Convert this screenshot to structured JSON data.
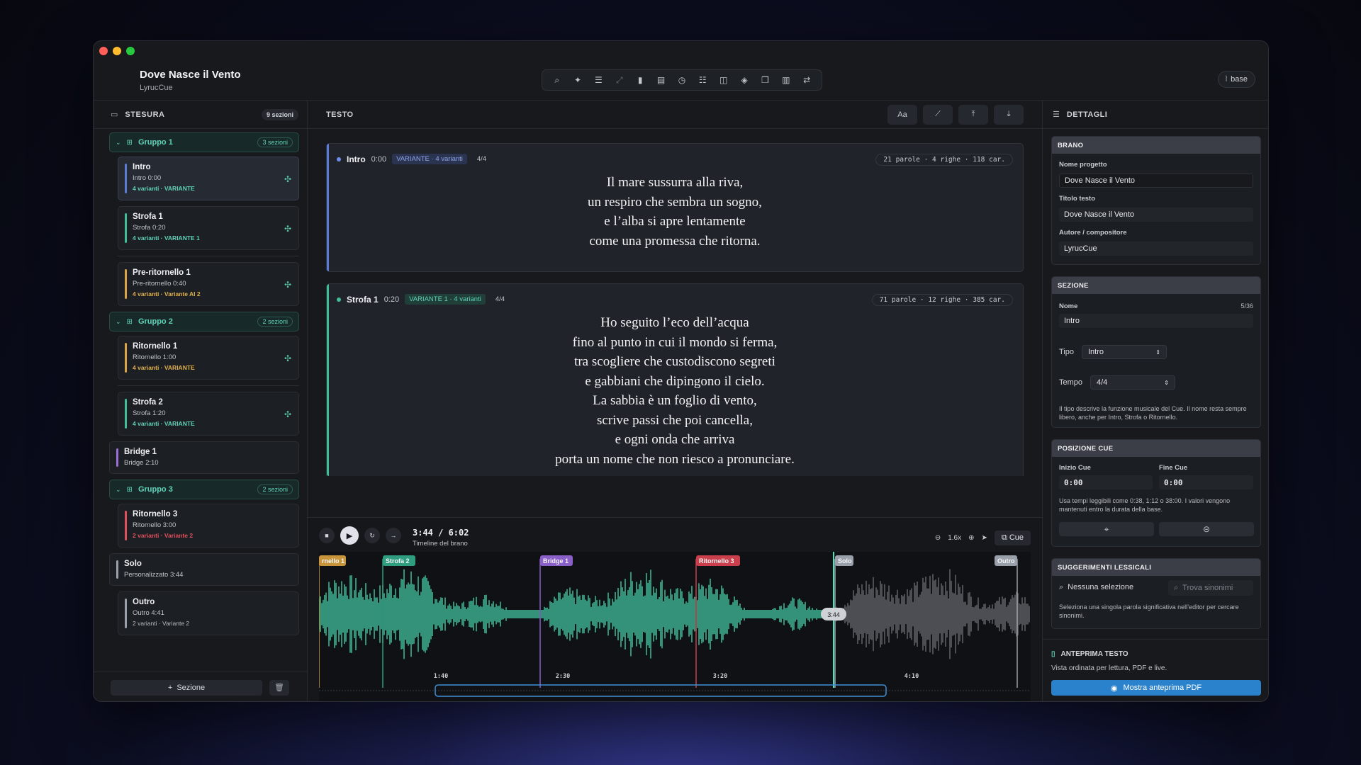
{
  "app": {
    "title": "Dove Nasce il Vento",
    "subtitle": "LyrucCue",
    "base_label": "base"
  },
  "toolbar_icons": [
    "search-icon",
    "sparkle-icon",
    "list-icon",
    "expand-icon",
    "waveform-icon",
    "document-icon",
    "timer-icon",
    "checklist-icon",
    "columns-icon",
    "layers-icon",
    "bookmark-icon",
    "notes-icon",
    "route-icon"
  ],
  "left": {
    "header": "STESURA",
    "count": "9 sezioni",
    "groups": [
      {
        "label": "Gruppo 1",
        "count": "3 sezioni"
      },
      {
        "label": "Gruppo 2",
        "count": "2 sezioni"
      },
      {
        "label": "Gruppo 3",
        "count": "2 sezioni"
      }
    ],
    "items": [
      {
        "name": "Intro",
        "meta": "Intro  0:00",
        "variant": "4 varianti · VARIANTE",
        "color": "#5b7bd8",
        "vcolor": "#5fd3b8"
      },
      {
        "name": "Strofa 1",
        "meta": "Strofa  0:20",
        "variant": "4 varianti · VARIANTE 1",
        "color": "#3fbf96",
        "vcolor": "#5fd3b8"
      },
      {
        "name": "Pre-ritornello 1",
        "meta": "Pre-ritornello  0:40",
        "variant": "4 varianti · Variante AI 2",
        "color": "#d9a441",
        "vcolor": "#e0b04c"
      },
      {
        "name": "Ritornello 1",
        "meta": "Ritornello  1:00",
        "variant": "4 varianti · VARIANTE",
        "color": "#d9a441",
        "vcolor": "#e0b04c"
      },
      {
        "name": "Strofa 2",
        "meta": "Strofa  1:20",
        "variant": "4 varianti · VARIANTE",
        "color": "#3fbf96",
        "vcolor": "#5fd3b8"
      },
      {
        "name": "Bridge 1",
        "meta": "Bridge  2:10",
        "variant": "",
        "color": "#9b6fd6",
        "vcolor": "#9b6fd6"
      },
      {
        "name": "Ritornello 3",
        "meta": "Ritornello  3:00",
        "variant": "2 varianti · Variante 2",
        "color": "#e0505c",
        "vcolor": "#e0505c"
      },
      {
        "name": "Solo",
        "meta": "Personalizzato  3:44",
        "variant": "",
        "color": "#9aa0aa",
        "vcolor": "#9aa0aa"
      },
      {
        "name": "Outro",
        "meta": "Outro  4:41",
        "variant": "2 varianti · Variante 2",
        "color": "#9aa0aa",
        "vcolor": "#b8bbc2"
      }
    ],
    "add_label": "Sezione"
  },
  "center": {
    "header": "TESTO",
    "tool_aa": "Aa",
    "cards": [
      {
        "name": "Intro",
        "time": "0:00",
        "variant": "VARIANTE · 4 varianti",
        "meter": "4/4",
        "stats": "21 parole · 4 righe · 118 car.",
        "lines": [
          "Il mare sussurra alla riva,",
          "un respiro che sembra un sogno,",
          "e l’alba si apre lentamente",
          "come una promessa che ritorna."
        ]
      },
      {
        "name": "Strofa 1",
        "time": "0:20",
        "variant": "VARIANTE 1 · 4 varianti",
        "meter": "4/4",
        "stats": "71 parole · 12 righe · 385 car.",
        "lines": [
          "Ho seguito l’eco dell’acqua",
          "fino al punto in cui il mondo si ferma,",
          "tra scogliere che custodiscono segreti",
          "e gabbiani che dipingono il cielo.",
          "La sabbia è un foglio di vento,",
          "scrive passi che poi cancella,",
          "e ogni onda che arriva",
          "porta un nome che non riesco a pronunciare."
        ]
      }
    ],
    "player": {
      "time": "3:44 / 6:02",
      "caption": "Timeline del brano",
      "zoom": "1.6x",
      "cue_label": "Cue",
      "playhead_label": "3:44",
      "markers": [
        {
          "label": "rnello 1",
          "color": "#c8953a"
        },
        {
          "label": "Strofa 2",
          "color": "#2f9e80"
        },
        {
          "label": "Bridge 1",
          "color": "#8a5fc8"
        },
        {
          "label": "Ritornello 3",
          "color": "#c9404c"
        },
        {
          "label": "Solo",
          "color": "#9aa0aa"
        },
        {
          "label": "Outro",
          "color": "#9aa0aa"
        }
      ],
      "ticks": [
        "1:40",
        "2:30",
        "3:20",
        "4:10"
      ]
    }
  },
  "right": {
    "header": "DETTAGLI",
    "brano": {
      "title": "BRANO",
      "project_label": "Nome progetto",
      "project": "Dove Nasce il Vento",
      "text_label": "Titolo testo",
      "text_title": "Dove Nasce il Vento",
      "author_label": "Autore / compositore",
      "author": "LyrucCue"
    },
    "sezione": {
      "title": "SEZIONE",
      "name_label": "Nome",
      "name_count": "5/36",
      "name": "Intro",
      "tipo_label": "Tipo",
      "tipo": "Intro",
      "tempo_label": "Tempo",
      "tempo": "4/4",
      "help": "Il tipo descrive la funzione musicale del Cue. Il nome resta sempre libero, anche per Intro, Strofa o Ritornello."
    },
    "cue": {
      "title": "POSIZIONE CUE",
      "start_label": "Inizio Cue",
      "start": "0:00",
      "end_label": "Fine Cue",
      "end": "0:00",
      "help": "Usa tempi leggibili come 0:38, 1:12 o 38:00. I valori vengono mantenuti entro la durata della base."
    },
    "lex": {
      "title": "SUGGERIMENTI LESSICALI",
      "none": "Nessuna selezione",
      "search_placeholder": "Trova sinonimi",
      "help": "Seleziona una singola parola significativa nell’editor per cercare sinonimi."
    },
    "preview": {
      "title": "ANTEPRIMA TESTO",
      "sub": "Vista ordinata per lettura, PDF e live.",
      "button": "Mostra anteprima PDF"
    }
  }
}
